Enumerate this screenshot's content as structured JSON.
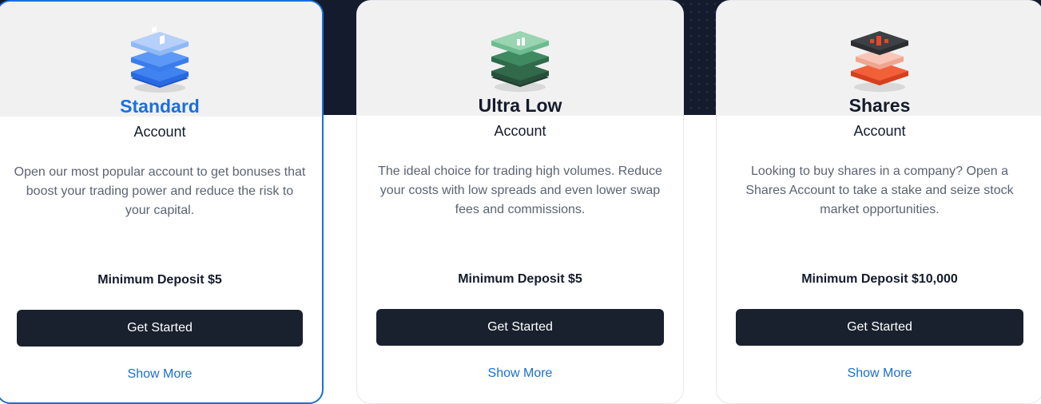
{
  "cards": [
    {
      "icon": "blue-layers-icon",
      "accent": "#2f78e4",
      "title": "Standard",
      "subtitle": "Account",
      "description": "Open our most popular account to get bonuses that boost your trading power and reduce the risk to your capital.",
      "deposit": "Minimum Deposit $5",
      "button": "Get Started",
      "link": "Show More",
      "selected": true
    },
    {
      "icon": "green-layers-icon",
      "accent": "#3f9d6c",
      "title": "Ultra Low",
      "subtitle": "Account",
      "description": "The ideal choice for trading high volumes. Reduce your costs with low spreads and even lower swap fees and commissions.",
      "deposit": "Minimum Deposit $5",
      "button": "Get Started",
      "link": "Show More",
      "selected": false
    },
    {
      "icon": "red-layers-icon",
      "accent": "#e9502c",
      "title": "Shares",
      "subtitle": "Account",
      "description": "Looking to buy shares in a company? Open a Shares Account to take a stake and seize stock market opportunities.",
      "deposit": "Minimum Deposit $10,000",
      "button": "Get Started",
      "link": "Show More",
      "selected": false
    }
  ],
  "colors": {
    "dark_bg": "#131b2c",
    "selected_border": "#1a6fe0",
    "button_bg": "#19202e",
    "link": "#1a6fcf"
  }
}
